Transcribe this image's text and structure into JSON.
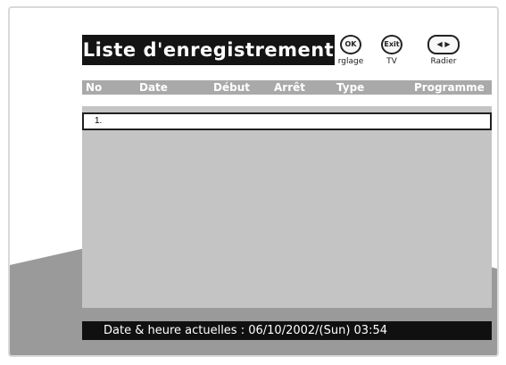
{
  "title": "Liste d'enregistrement",
  "hints": [
    {
      "key": "OK",
      "label": "rglage"
    },
    {
      "key": "Exit",
      "label": "TV"
    },
    {
      "key": "◀ ▶",
      "label": "Radier"
    }
  ],
  "columns": {
    "no": "No",
    "date": "Date",
    "debut": "Début",
    "arret": "Arrêt",
    "type": "Type",
    "programme": "Programme"
  },
  "rows": [
    {
      "no": "1."
    }
  ],
  "status": "Date & heure actuelles : 06/10/2002/(Sun)   03:54",
  "colors": {
    "title_bg": "#141414",
    "header_bg": "#a9a9a9",
    "panel_bg": "#c4c4c4",
    "status_bg": "#101010",
    "floor": "#9a9a9a"
  }
}
